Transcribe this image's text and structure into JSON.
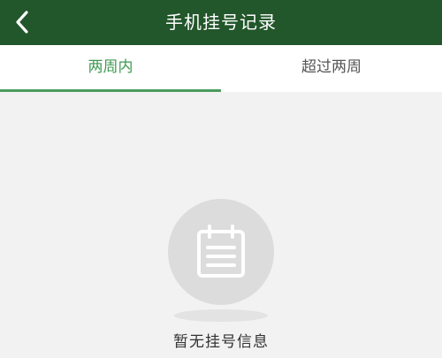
{
  "header": {
    "back_icon": "chevron-left-icon",
    "title": "手机挂号记录"
  },
  "tabs": [
    {
      "label": "两周内",
      "active": true
    },
    {
      "label": "超过两周",
      "active": false
    }
  ],
  "empty_state": {
    "icon": "calendar-icon",
    "message": "暂无挂号信息"
  },
  "colors": {
    "header_bg": "#22562b",
    "accent": "#4a9c5c",
    "background": "#f2f2f2"
  }
}
